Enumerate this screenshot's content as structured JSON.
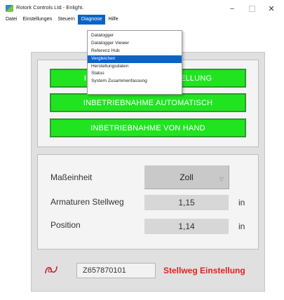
{
  "window": {
    "title": "Rotork Controls Ltd - Enlight.",
    "minimize": "–",
    "close": "✕"
  },
  "menubar": {
    "items": [
      "Datei",
      "Einstellungen",
      "Steuern",
      "Diagnose",
      "Hilfe"
    ],
    "active_index": 3
  },
  "dropdown": {
    "items": [
      "Datalogger",
      "Datalogger Viewer",
      "Referenz Hub",
      "Vergleichen",
      "Herstellungsdaten",
      "Status",
      "System Zusammenfassung"
    ],
    "highlighted_index": 3
  },
  "buttons": {
    "b1": "INBETRIEBNAHME EINSTELLUNG",
    "b2": "INBETRIEBNAHME AUTOMATISCH",
    "b3": "INBETRIEBNAHME VON HAND"
  },
  "settings": {
    "unit_label": "Maßeinheit",
    "unit_value": "Zoll",
    "travel_label": "Armaturen Stellweg",
    "travel_value": "1,15",
    "travel_unit": "in",
    "position_label": "Position",
    "position_value": "1,14",
    "position_unit": "in"
  },
  "footer": {
    "icon": "signal-icon",
    "serial": "Z657870101",
    "status": "Stellweg Einstellung"
  },
  "colors": {
    "accent": "#0a64c8",
    "green_button": "#21e421",
    "status_red": "#e41e1e"
  }
}
